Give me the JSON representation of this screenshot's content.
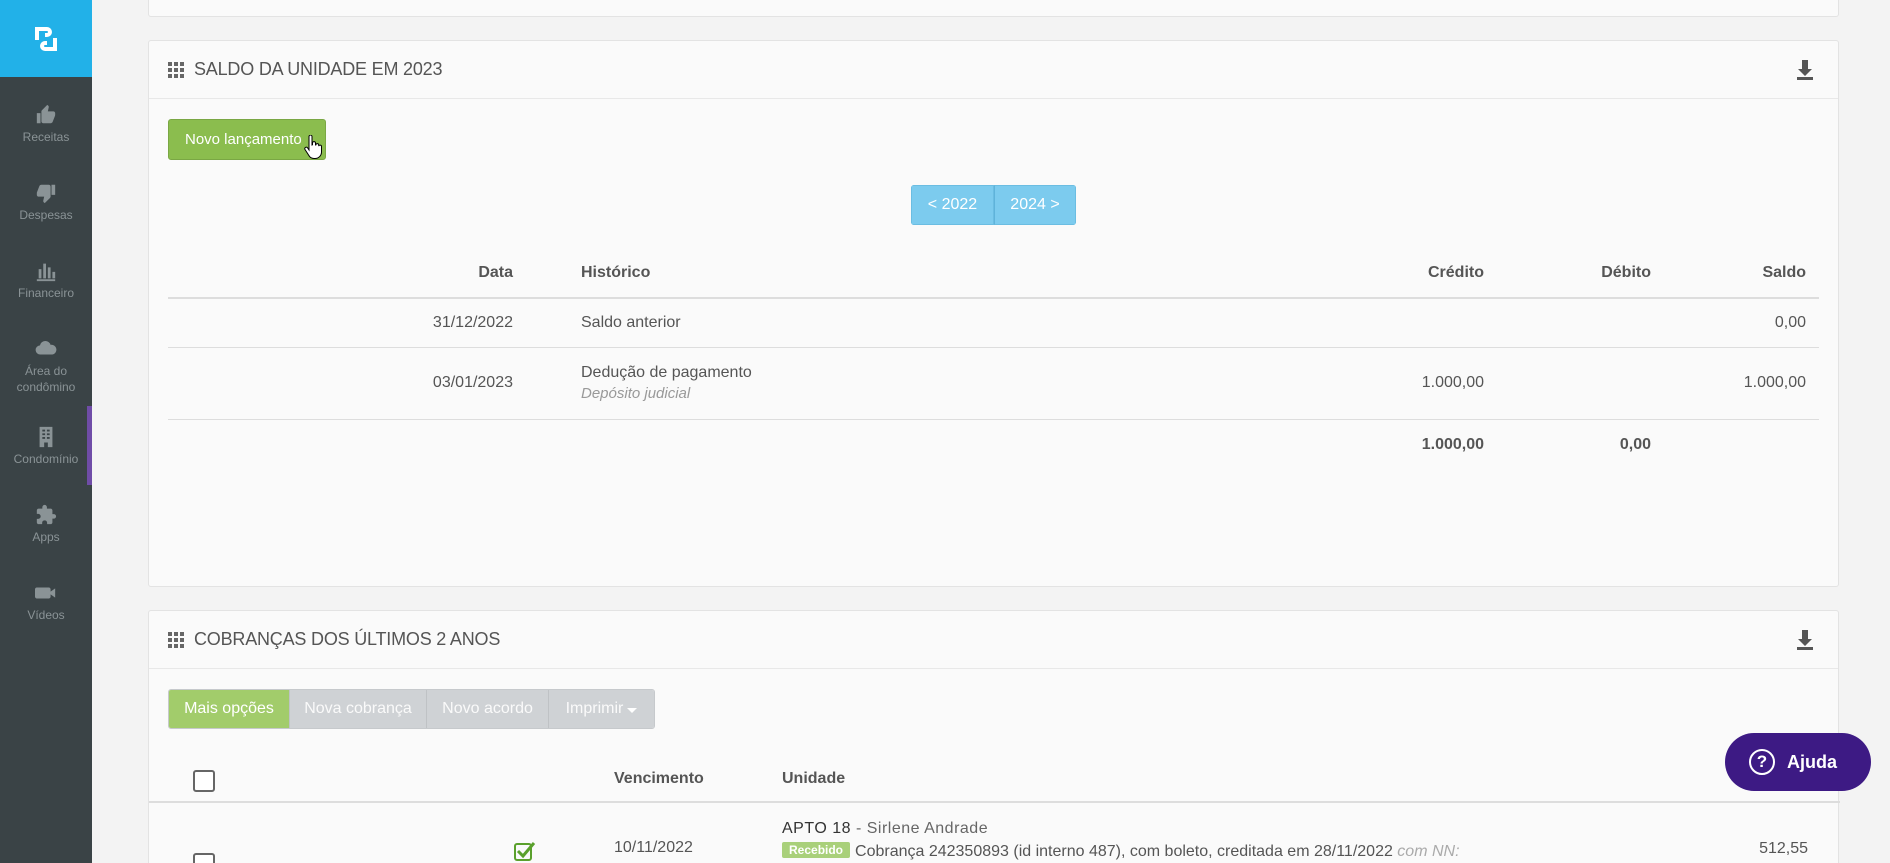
{
  "sidebar": {
    "items": [
      {
        "label": "Receitas",
        "icon": "thumbs-up-icon"
      },
      {
        "label": "Despesas",
        "icon": "thumbs-down-icon"
      },
      {
        "label": "Financeiro",
        "icon": "bar-chart-icon"
      },
      {
        "label": "Área do condômino",
        "icon": "cloud-icon"
      },
      {
        "label": "Condomínio",
        "icon": "building-icon"
      },
      {
        "label": "Apps",
        "icon": "puzzle-icon"
      },
      {
        "label": "Vídeos",
        "icon": "video-camera-icon"
      }
    ],
    "active_index": 4,
    "active_color": "#6f4ca7",
    "logo_color": "#22b1e8"
  },
  "saldo": {
    "title": "SALDO DA UNIDADE EM 2023",
    "new_button": "Novo lançamento",
    "prev_year": "< 2022",
    "next_year": "2024 >",
    "columns": {
      "data": "Data",
      "historico": "Histórico",
      "credito": "Crédito",
      "debito": "Débito",
      "saldo": "Saldo"
    },
    "rows": [
      {
        "data": "31/12/2022",
        "historico": "Saldo anterior",
        "sub": "",
        "credito": "",
        "debito": "",
        "saldo": "0,00"
      },
      {
        "data": "03/01/2023",
        "historico": "Dedução de pagamento",
        "sub": "Depósito judicial",
        "credito": "1.000,00",
        "debito": "",
        "saldo": "1.000,00"
      }
    ],
    "totals": {
      "credito": "1.000,00",
      "debito": "0,00"
    }
  },
  "cobrancas": {
    "title": "COBRANÇAS DOS ÚLTIMOS 2 ANOS",
    "buttons": {
      "mais": "Mais opções",
      "nova": "Nova cobrança",
      "acordo": "Novo acordo",
      "imprimir": "Imprimir"
    },
    "columns": {
      "vencimento": "Vencimento",
      "unidade": "Unidade"
    },
    "row": {
      "vencimento": "10/11/2022",
      "unidade": "APTO 18",
      "nome": " - Sirlene Andrade",
      "badge": "Recebido",
      "descricao": "Cobrança 242350893 (id interno 487), com boleto, creditada em 28/11/2022",
      "nn": " com NN:",
      "valor": "512,55"
    }
  },
  "help": {
    "label": "Ajuda",
    "icon": "question-circle-icon"
  }
}
